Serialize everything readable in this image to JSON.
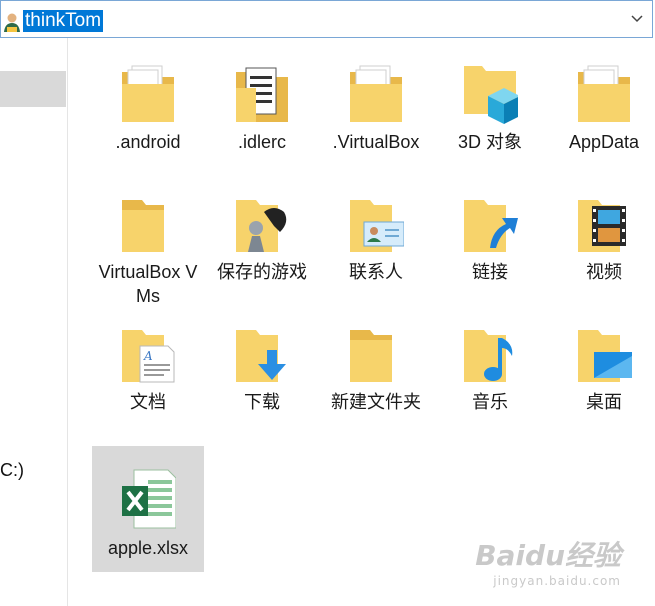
{
  "address": {
    "text": "thinkTom"
  },
  "nav": {
    "drive_label": "C:)"
  },
  "files": [
    {
      "label": ".android",
      "icon": "folder-documents-icon"
    },
    {
      "label": ".idlerc",
      "icon": "folder-black-documents-icon"
    },
    {
      "label": ".VirtualBox",
      "icon": "folder-documents-icon"
    },
    {
      "label": "3D 对象",
      "icon": "3d-objects-folder-icon"
    },
    {
      "label": "AppData",
      "icon": "folder-documents-icon"
    },
    {
      "label": "VirtualBox VMs",
      "icon": "folder-icon"
    },
    {
      "label": "保存的游戏",
      "icon": "saved-games-folder-icon"
    },
    {
      "label": "联系人",
      "icon": "contacts-folder-icon"
    },
    {
      "label": "链接",
      "icon": "links-folder-icon"
    },
    {
      "label": "视频",
      "icon": "videos-folder-icon"
    },
    {
      "label": "文档",
      "icon": "documents-folder-icon"
    },
    {
      "label": "下载",
      "icon": "downloads-folder-icon"
    },
    {
      "label": "新建文件夹",
      "icon": "folder-icon"
    },
    {
      "label": "音乐",
      "icon": "music-folder-icon"
    },
    {
      "label": "桌面",
      "icon": "desktop-folder-icon"
    },
    {
      "label": "apple.xlsx",
      "icon": "excel-file-icon",
      "selected": true
    }
  ],
  "watermark": {
    "main": "Baidu经验",
    "sub": "jingyan.baidu.com"
  },
  "colors": {
    "folder": "#f7d36b",
    "folder_dark": "#e8b84a",
    "selection": "#d9d9d9",
    "address_highlight": "#0078d7"
  }
}
